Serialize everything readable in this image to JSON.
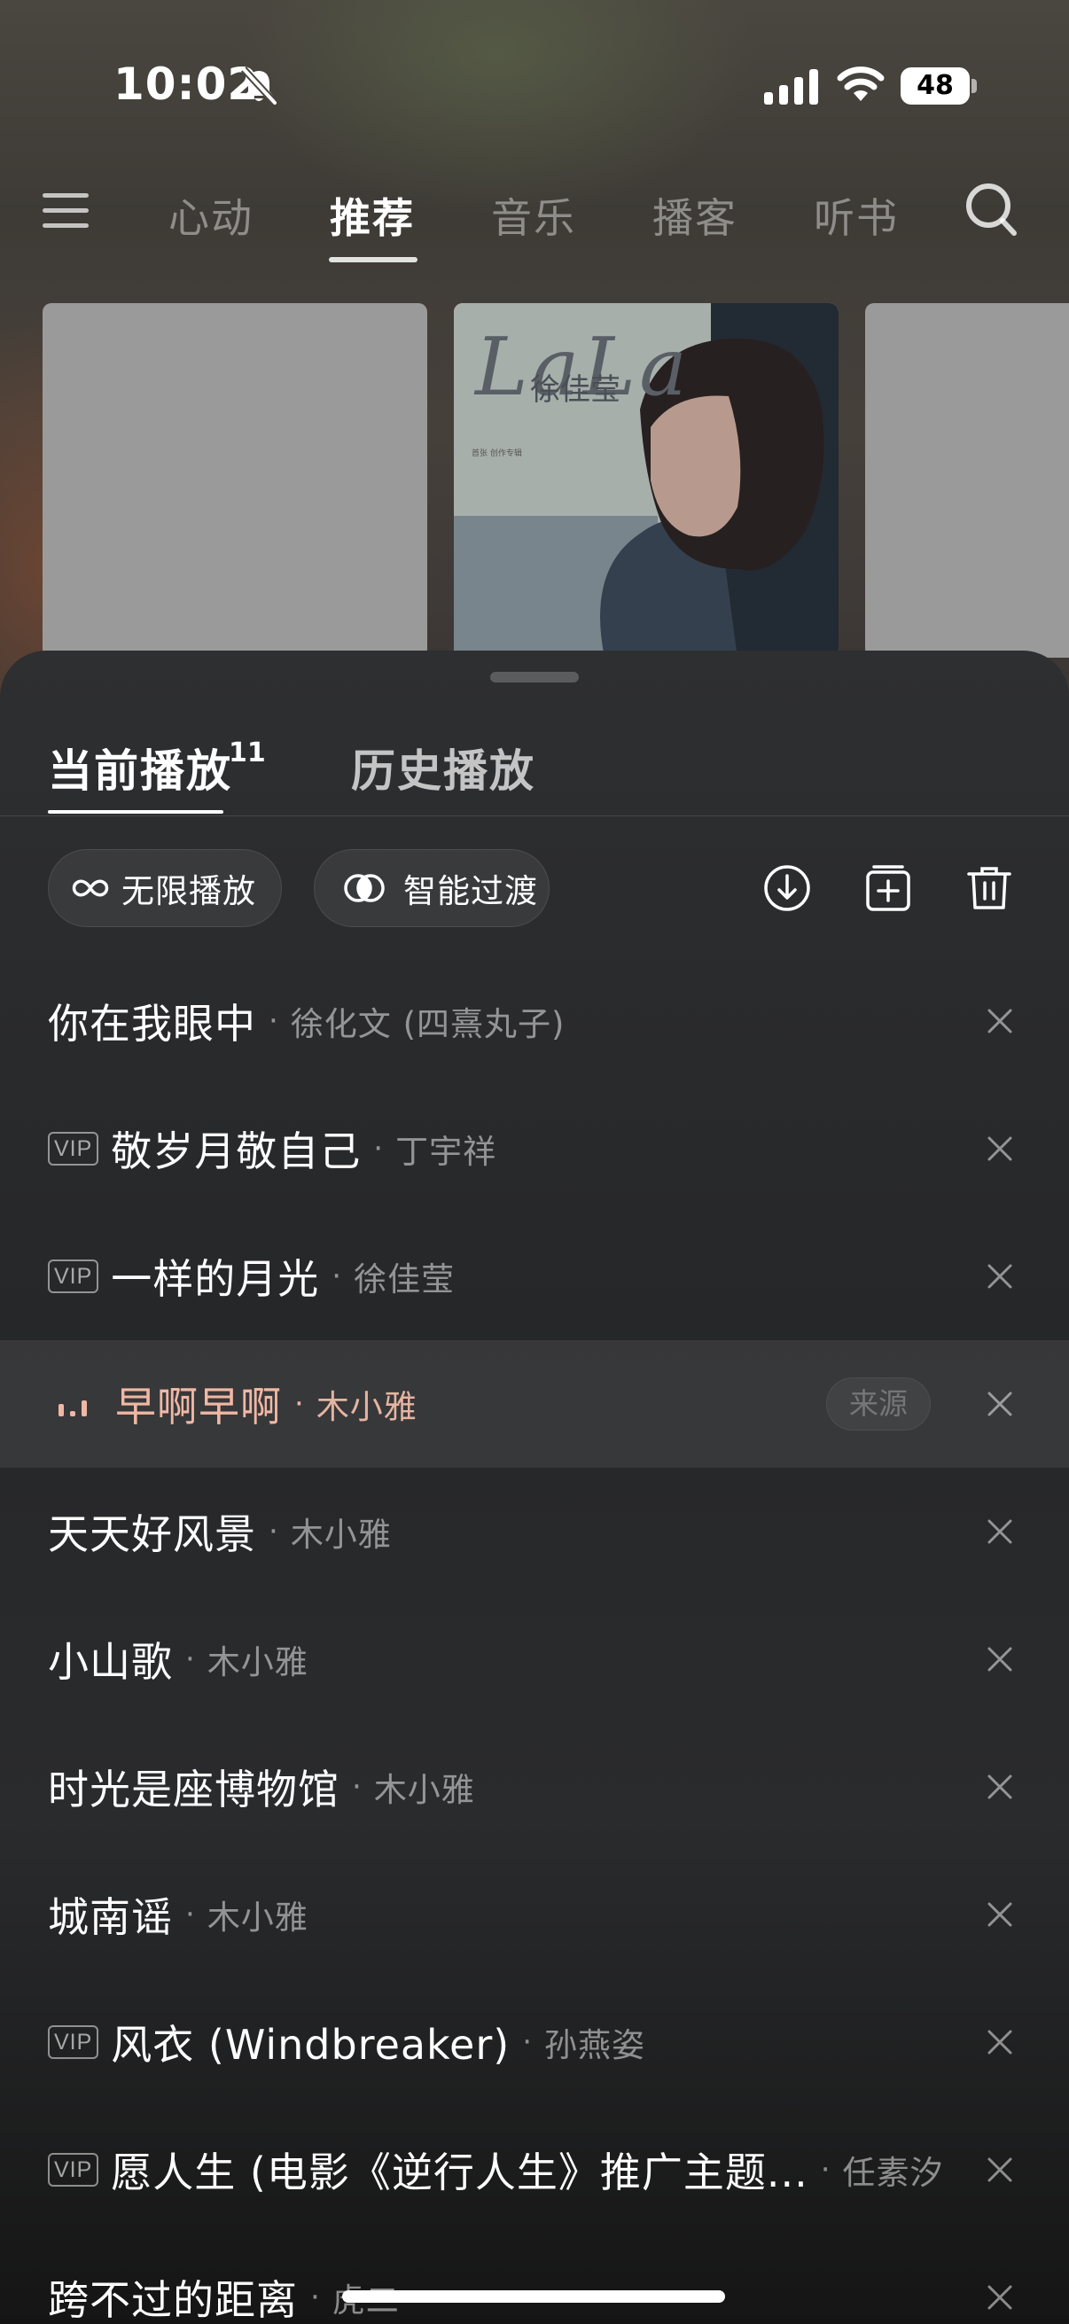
{
  "status_bar": {
    "time": "10:02",
    "battery": "48"
  },
  "top_nav": {
    "tabs": [
      {
        "label": "心动",
        "active": false
      },
      {
        "label": "推荐",
        "active": true
      },
      {
        "label": "音乐",
        "active": false
      },
      {
        "label": "播客",
        "active": false
      },
      {
        "label": "听书",
        "active": false
      }
    ]
  },
  "carousel": {
    "album": {
      "title": "LaLa",
      "artist": "徐佳莹",
      "subtitle": "首张 创作专辑"
    }
  },
  "sheet": {
    "tabs": {
      "current": "当前播放",
      "current_count": "11",
      "history": "历史播放"
    },
    "modes": {
      "loop": "无限播放",
      "crossfade": "智能过渡"
    },
    "source_label": "来源",
    "vip_label": "VIP",
    "separator": "·",
    "songs": [
      {
        "title": "你在我眼中",
        "artist": "徐化文 (四熹丸子)",
        "vip": false,
        "playing": false
      },
      {
        "title": "敬岁月敬自己",
        "artist": "丁宇祥",
        "vip": true,
        "playing": false
      },
      {
        "title": "一样的月光",
        "artist": "徐佳莹",
        "vip": true,
        "playing": false
      },
      {
        "title": "早啊早啊",
        "artist": "木小雅",
        "vip": false,
        "playing": true
      },
      {
        "title": "天天好风景",
        "artist": "木小雅",
        "vip": false,
        "playing": false
      },
      {
        "title": "小山歌",
        "artist": "木小雅",
        "vip": false,
        "playing": false
      },
      {
        "title": "时光是座博物馆",
        "artist": "木小雅",
        "vip": false,
        "playing": false
      },
      {
        "title": "城南谣",
        "artist": "木小雅",
        "vip": false,
        "playing": false
      },
      {
        "title": "风衣 (Windbreaker)",
        "artist": "孙燕姿",
        "vip": true,
        "playing": false
      },
      {
        "title": "愿人生 (电影《逆行人生》推广主题...",
        "artist": "任素汐",
        "vip": true,
        "playing": false
      },
      {
        "title": "跨不过的距离",
        "artist": "虎二",
        "vip": false,
        "playing": false
      }
    ]
  },
  "colors": {
    "playing_accent": "#f0b8a4",
    "sheet_bg": "#2a2b2d"
  }
}
